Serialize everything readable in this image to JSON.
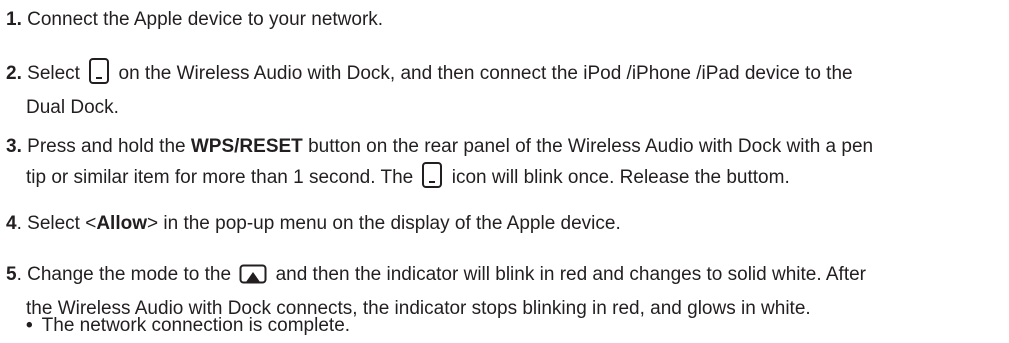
{
  "steps": [
    {
      "number": "1.",
      "text": "Connect the Apple device to your network."
    },
    {
      "number": "2.",
      "before": "Select",
      "after": "on the Wireless Audio with Dock, and then connect the iPod /iPhone /iPad device to the",
      "cont": "Dual Dock.",
      "icon": "dock-mode-icon"
    },
    {
      "number": "3.",
      "before": "Press and hold the",
      "bold": "WPS/RESET",
      "after": "button on the rear panel of the Wireless Audio with Dock with a pen",
      "cont_before": "tip or similar item for more than 1 second. The",
      "cont_after": "icon will blink once. Release the buttom.",
      "icon": "dock-mode-icon"
    },
    {
      "number": "4",
      "punct": ".",
      "before": "Select <",
      "bold": "Allow",
      "after": "> in the pop-up menu on the display of the Apple device."
    },
    {
      "number": "5",
      "punct": ".",
      "before": "Change the mode to the",
      "after": "and then the indicator will blink in red and changes to solid white. After",
      "cont": "the Wireless Audio with Dock connects, the indicator stops blinking in red, and glows in white.",
      "icon": "airplay-icon"
    }
  ],
  "bullet": {
    "symbol": "•",
    "text": "The network connection is complete."
  }
}
